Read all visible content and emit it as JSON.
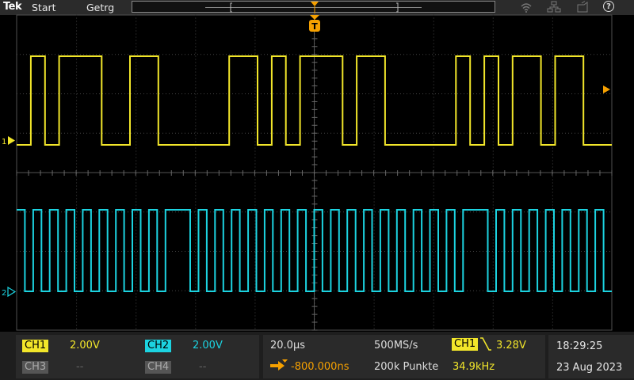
{
  "app": {
    "logo": "Tek",
    "menu": [
      "Start",
      "Getrg"
    ],
    "help_glyph": "?",
    "icons": [
      "wifi-icon",
      "network-icon",
      "save-icon",
      "help-icon"
    ]
  },
  "waveforms": {
    "ch1_color": "#f2e62a",
    "ch2_color": "#1cd3e0",
    "ch1_marker": "1",
    "ch2_marker": "2",
    "ch1_bits": [
      0,
      1,
      0,
      1,
      1,
      1,
      0,
      0,
      1,
      1,
      0,
      0,
      0,
      0,
      0,
      1,
      1,
      0,
      1,
      0,
      1,
      1,
      1,
      0,
      1,
      1,
      0,
      0,
      0,
      0,
      0,
      1,
      0,
      1,
      0,
      1,
      1,
      0,
      1,
      1,
      0,
      0
    ],
    "ch2_bits": [
      1,
      0,
      1,
      0,
      1,
      0,
      1,
      0,
      1,
      0,
      1,
      0,
      1,
      0,
      1,
      0,
      1,
      0,
      1,
      1,
      1,
      0,
      1,
      0,
      1,
      0,
      1,
      0,
      1,
      0,
      1,
      0,
      1,
      0,
      1,
      0,
      1,
      0,
      1,
      0,
      1,
      0,
      1,
      0,
      1,
      0,
      1,
      0,
      1,
      0,
      1,
      0,
      1,
      0,
      1,
      1,
      1,
      0,
      1,
      0,
      1,
      0,
      1,
      0,
      1,
      0,
      1,
      0,
      1,
      0,
      1,
      0
    ]
  },
  "trigger": {
    "marker_label": "T"
  },
  "channels": {
    "ch1": {
      "label": "CH1",
      "scale": "2.00V",
      "color": "#f2e62a"
    },
    "ch2": {
      "label": "CH2",
      "scale": "2.00V",
      "color": "#1cd3e0"
    },
    "ch3": {
      "label": "CH3",
      "scale": "--"
    },
    "ch4": {
      "label": "CH4",
      "scale": "--"
    }
  },
  "horizontal": {
    "time_per_div": "20.0µs",
    "sample_rate": "500MS/s",
    "position": "-800.000ns",
    "record_length": "200k Punkte"
  },
  "trigger_panel": {
    "source": "CH1",
    "level": "3.28V",
    "frequency": "34.9kHz"
  },
  "clock": {
    "time": "18:29:25",
    "date": "23 Aug 2023"
  },
  "accent": "#f5a000"
}
